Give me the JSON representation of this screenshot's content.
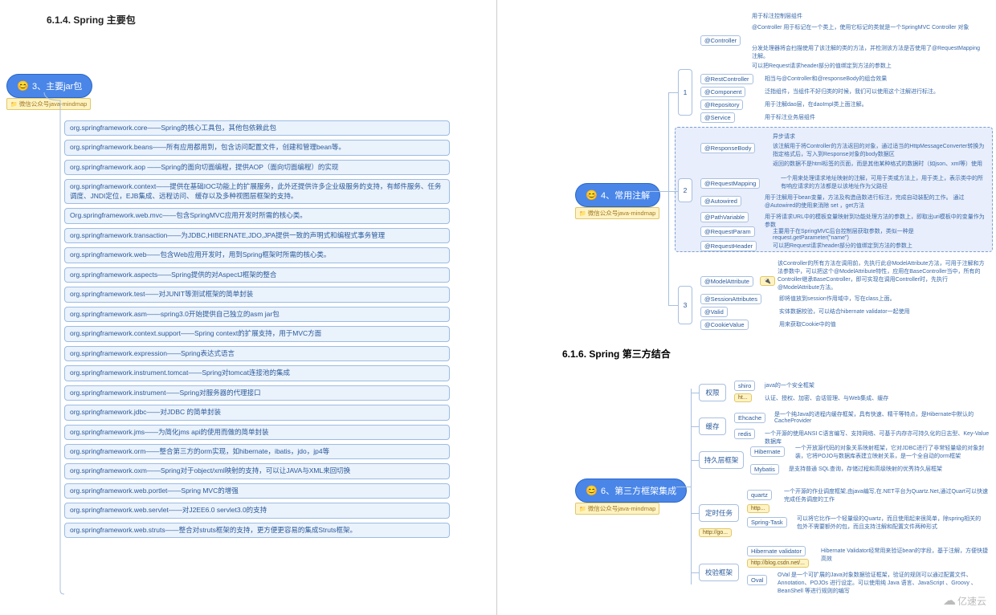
{
  "sections": {
    "s614": "6.1.4.  Spring 主要包",
    "s616": "6.1.6.  Spring 第三方结合"
  },
  "watermark": "亿速云",
  "footer_tag": "微信公众号java-mindmap",
  "root3": "3、主要jar包",
  "root4": "4、常用注解",
  "root6": "6、第三方框架集成",
  "jars": [
    "org.springframework.core——Spring的核心工具包，其他包依赖此包",
    "org.springframework.beans——所有应用都用到，包含访问配置文件，创建和管理bean等。",
    "org.springframework.aop ——Spring的面向切面编程，提供AOP（面向切面编程）的实现",
    "org.springframework.context——提供在基础IOC功能上的扩展服务，此外还提供许多企业级服务的支持，有邮件服务、任务调度、JNDI定位，EJB集成、远程访问、 缓存以及多种视图层框架的支持。",
    "Org.springframework.web.mvc——包含SpringMVC应用开发时所需的核心类。",
    "org.springframework.transaction——为JDBC,HIBERNATE,JDO,JPA提供一致的声明式和编程式事务管理",
    "org.springframework.web——包含Web应用开发时，用到Spring框架时所需的核心类。",
    "org.springframework.aspects——Spring提供的对AspectJ框架的整合",
    "org.springframework.test——对JUNIT等测试框架的简单封装",
    "org.springframework.asm——spring3.0开始提供自己独立的asm jar包",
    "org.springframework.context.support——Spring context的扩展支持，用于MVC方面",
    "org.springframework.expression——Spring表达式语言",
    "org.springframework.instrument.tomcat——Spring对tomcat连接池的集成",
    "org.springframework.instrument——Spring对服务器的代理接口",
    "org.springframework.jdbc——对JDBC 的简单封装",
    "org.springframework.jms——为简化jms api的使用而做的简单封装",
    "org.springframework.orm——整合第三方的orm实现，如hibernate，ibatis，jdo，jp4等",
    "org.springframework.oxm——Spring对于object/xml映射的支持，可以让JAVA与XML来回切换",
    "org.springframework.web.portlet——Spring MVC的增强",
    "org.springframework.web.servlet——对J2EE6.0 servlet3.0的支持",
    "org.springframework.web.struts——整合对struts框架的支持，更方便更容易的集成Struts框架。"
  ],
  "r4": {
    "g1": {
      "num": "1",
      "controller": "@Controller",
      "controller_desc": [
        "用于标注控制层组件",
        "@Controller 用于标记在一个类上，使用它标记的类就是一个SpringMVC Controller 对象",
        "分发处理器将会扫描使用了该注解的类的方法，并检测该方法是否使用了@RequestMapping 注解。",
        "可以把Request请求header部分的值绑定到方法的参数上"
      ],
      "restcontroller": "@RestController",
      "restcontroller_desc": "相当与@Controller和@responseBody的组合效果",
      "component": "@Component",
      "component_desc": "泛指组件，当组件不好归类的时候，我们可以使用这个注解进行标注。",
      "repository": "@Repository",
      "repository_desc": "用于注解dao层，在daoImpl类上面注解。",
      "service": "@Service",
      "service_desc": "用于标注业务层组件"
    },
    "g2": {
      "num": "2",
      "responsebody": "@ResponseBody",
      "responsebody_desc": [
        "异步请求",
        "该注解用于将Controller的方法返回的对象，通过适当的HttpMessageConverter转换为指定格式后，写入到Response对象的body数据区",
        "返回的数据不是html标签的页面，而是其他某种格式的数据时（如json、xml等）使用"
      ],
      "requestmapping": "@RequestMapping",
      "requestmapping_desc": "一个用来处理请求地址映射的注解，可用于类或方法上，用于类上，表示类中的所有响应请求的方法都是以该地址作为父路径",
      "autowired": "@Autowired",
      "autowired_desc": "用于注解用于bean变量，方法及构造函数进行标注，完成自动装配的工作。 通过 @Autowired的使用来消除 set ，get方法",
      "pathvariable": "@PathVariable",
      "pathvariable_desc": "用于将请求URL中的模板变量映射到功能处理方法的参数上，即取出uri模板中的变量作为参数",
      "requestparam": "@RequestParam",
      "requestparam_desc": "主要用于在SpringMVC后台控制层获取参数，类似一种是request.getParameter(\"name\")",
      "requestheader": "@RequestHeader",
      "requestheader_desc": "可以把Request请求header部分的值绑定到方法的参数上"
    },
    "g3": {
      "num": "3",
      "modelattribute": "@ModelAttribute",
      "modelattribute_desc": "该Controller的所有方法在调用前，先执行此@ModelAttribute方法，可用于注解和方法参数中，可以把这个@ModelAttribute特性，应用在BaseController当中，所有的Controller继承BaseController，即可实现在调用Controller时，先执行@ModelAttribute方法。",
      "sessionattributes": "@SessionAttributes",
      "sessionattributes_desc": "即将值放到session作用域中，写在class上面。",
      "valid": "@Valid",
      "valid_desc": "实体数据校验，可以结合hibernate validator一起使用",
      "cookievalue": "@CookieValue",
      "cookievalue_desc": "用来获取Cookie中的值"
    }
  },
  "r6": {
    "perm": {
      "label": "权限",
      "shiro": "shiro",
      "shiro_desc": "java的一个安全框架",
      "shiro_desc2": "认证、授权、加密、会话管理、与Web集成、缓存",
      "ht": "ht..."
    },
    "cache": {
      "label": "缓存",
      "ehcache": "Ehcache",
      "ehcache_desc": "是一个纯Java的进程内缓存框架，具有快速、精干等特点，是Hibernate中默认的CacheProvider",
      "redis": "redis",
      "redis_desc": "一个开源的使用ANSI C语言编写、支持网络、可基于内存亦可持久化的日志型、Key-Value数据库"
    },
    "orm": {
      "label": "持久层框架",
      "hibernate": "Hibernate",
      "hibernate_desc": "一个开放源代码的对象关系映射框架，它对JDBC进行了非常轻量级的对象封装，它将POJO与数据库表建立映射关系，是一个全自动的orm框架",
      "mybatis": "Mybatis",
      "mybatis_desc": "是支持普通 SQL查询，存储过程和高级映射的优秀持久层框架"
    },
    "task": {
      "label": "定时任务",
      "quartz": "quartz",
      "quartz_desc": "一个开源的作业调度框架,由java编写,在.NET平台为Quartz.Net,通过Quart可以快速完成任务调度的工作",
      "http": "http...",
      "springtask": "Spring-Task",
      "springtask_desc": "可以将它比作一个轻量级的Quartz，而且使用起来很简单，除spring相关的包外不需要额外的包，而且支持注解和配置文件两种形式",
      "httpgo": "http://go..."
    },
    "valid": {
      "label": "校验框架",
      "hv": "Hibernate validator",
      "hv_desc": "Hibernate Validator经常用来验证bean的字段，基于注解，方便快捷高效",
      "hv_link": "http://blog.csdn.net/...",
      "oval": "Oval",
      "oval_desc": "OVal 是一个可扩展的Java对象数据验证框架，验证的规则可以通过配置文件、Annotation、POJOs 进行设定。可以使用纯 Java 语言、JavaScript 、Groovy 、BeanShell 等进行规则的编写"
    }
  }
}
